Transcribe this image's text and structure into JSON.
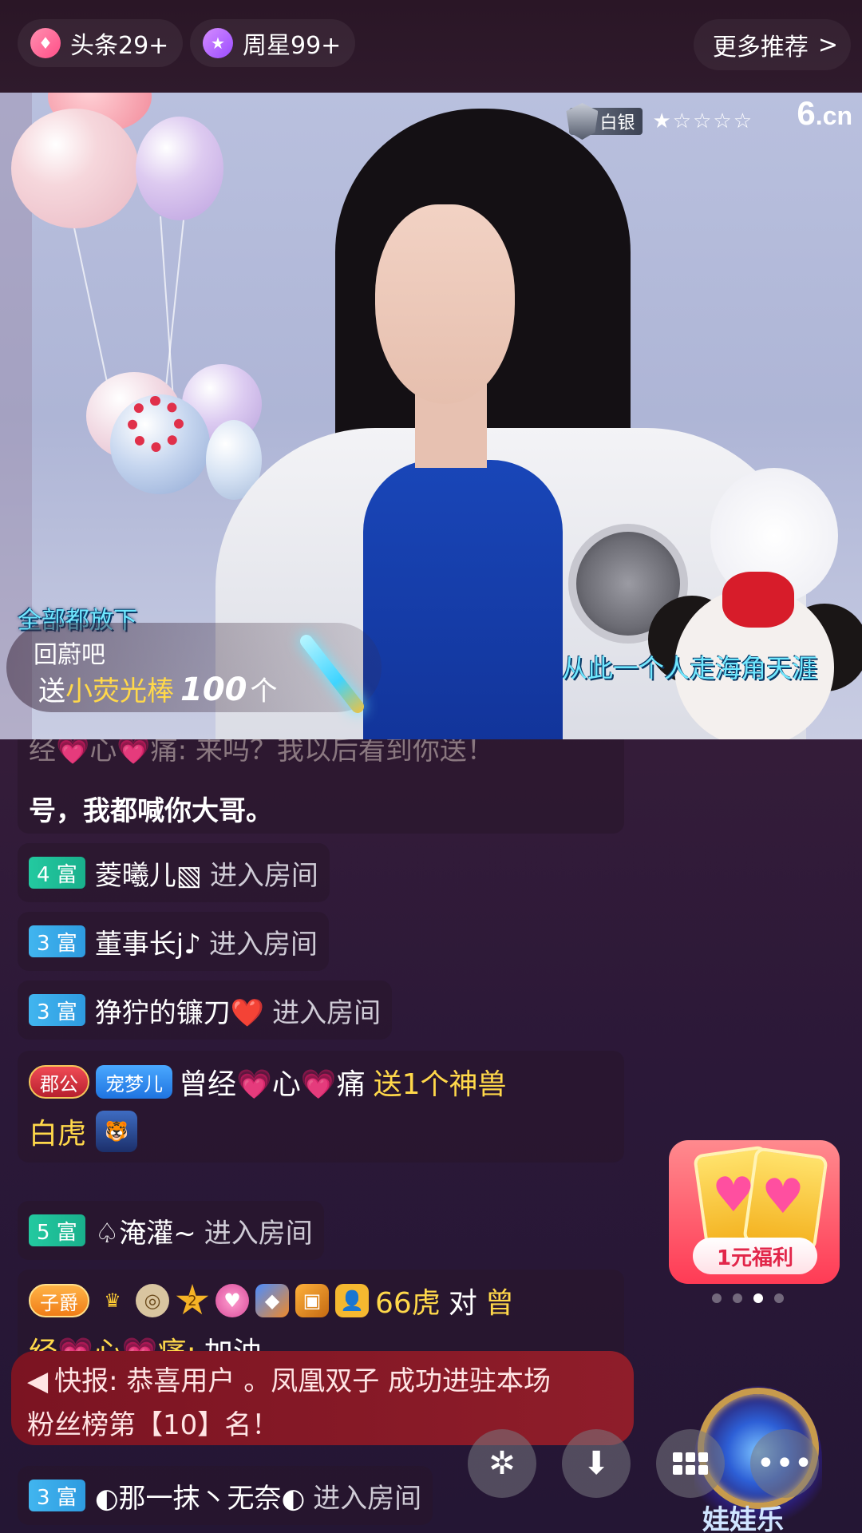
{
  "topbar": {
    "pill1_label": "头条29+",
    "pill2_label": "周星99+",
    "more_label": "更多推荐",
    "more_chevron": ">"
  },
  "video": {
    "rank_label": "白银",
    "rank_stars": "★☆☆☆☆",
    "logo": "6",
    "logo_suffix": ".cn",
    "caption_left": "全部都放下",
    "caption_right": "从此一个人走海角天涯",
    "gift": {
      "user": "回蔚吧",
      "send": "送",
      "gift_name": "小荧光棒",
      "count": "100",
      "unit": "个"
    }
  },
  "chat": {
    "cut_line1": "经💗心💗痛: 来吗？我以后看到你送！",
    "cut_line2": "号，我都喊你大哥。",
    "enter_text": "进入房间",
    "rows": [
      {
        "level": "4 富",
        "user": "菱曦儿▧"
      },
      {
        "level": "3 富",
        "user": "董事长j♪"
      },
      {
        "level": "3 富",
        "user": "狰狞的镰刀❤️"
      },
      {
        "level": "5 富",
        "user": "♤淹灌~"
      },
      {
        "level": "3 富",
        "user": "◐那一抹丶无奈◐"
      }
    ],
    "gift_msg": {
      "tag1": "郡公",
      "tag2": "宠梦儿",
      "user": "曾经💗心💗痛",
      "action": "送1个神兽",
      "gift": "白虎"
    },
    "cheer_msg": {
      "tag1": "子爵",
      "level_num": "2",
      "user": "66虎",
      "to": "对",
      "target_part1": "曾",
      "target_part2": "经💗心💗痛:",
      "text": "加油"
    },
    "news": {
      "line1": "快报: 恭喜用户 。凤凰双子 成功进驻本场",
      "line2": "粉丝榜第【10】名！"
    }
  },
  "promo": {
    "label": "1元福利",
    "page_index": 3,
    "page_count": 4
  },
  "orb_text": "娃娃乐"
}
